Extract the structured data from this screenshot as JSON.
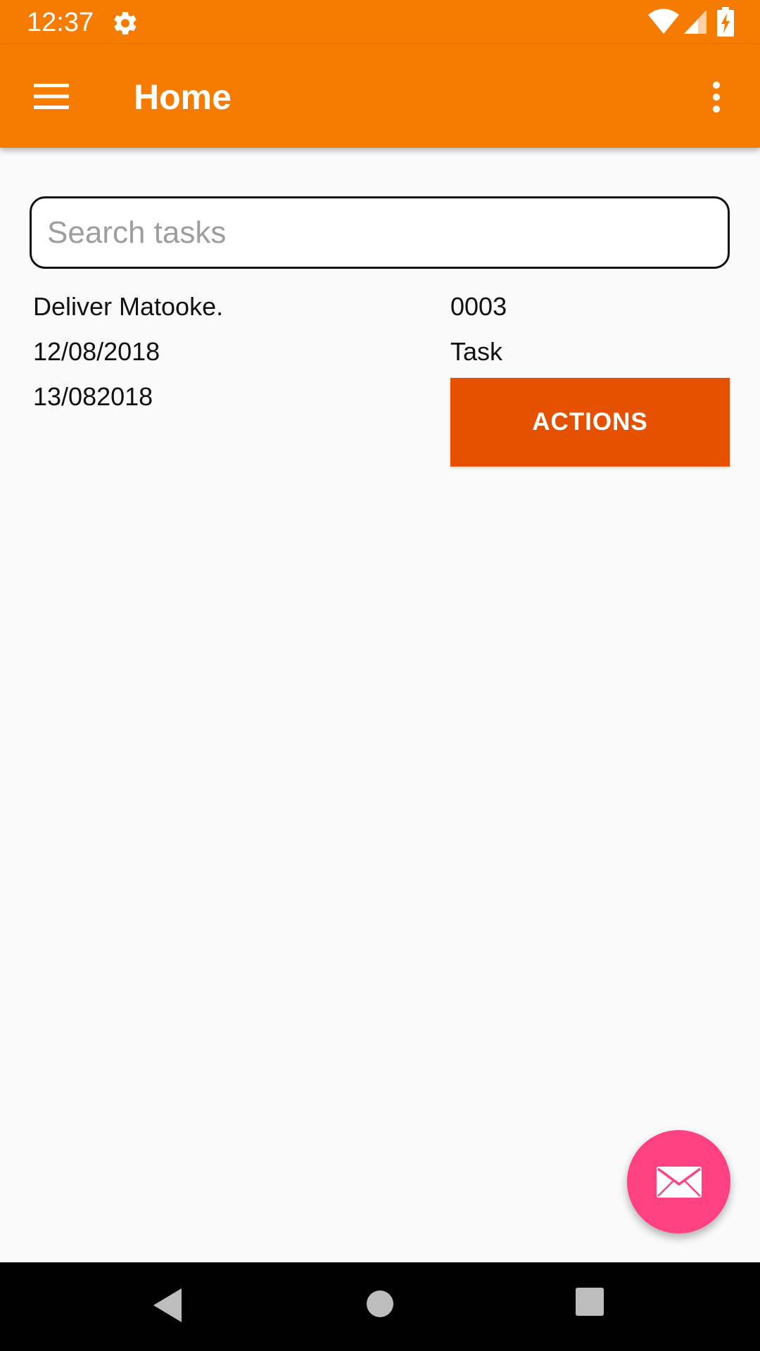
{
  "status_bar": {
    "time": "12:37",
    "icons": [
      "gear-icon",
      "wifi-icon",
      "signal-icon",
      "battery-charging-icon"
    ]
  },
  "app_bar": {
    "title": "Home",
    "menu_icon": "hamburger-menu-icon",
    "overflow_icon": "more-vert-icon",
    "background_color": "#f57c00"
  },
  "search": {
    "placeholder": "Search tasks",
    "value": ""
  },
  "task": {
    "name": "Deliver Matooke.",
    "start_date": "12/08/2018",
    "end_date": "13/082018",
    "number": "0003",
    "type": "Task",
    "actions_label": "ACTIONS",
    "actions_color": "#e65100"
  },
  "fab": {
    "icon": "mail-icon",
    "color": "#ff4081"
  },
  "nav_bar": {
    "icons": [
      "back-icon",
      "home-icon",
      "recents-icon"
    ]
  }
}
